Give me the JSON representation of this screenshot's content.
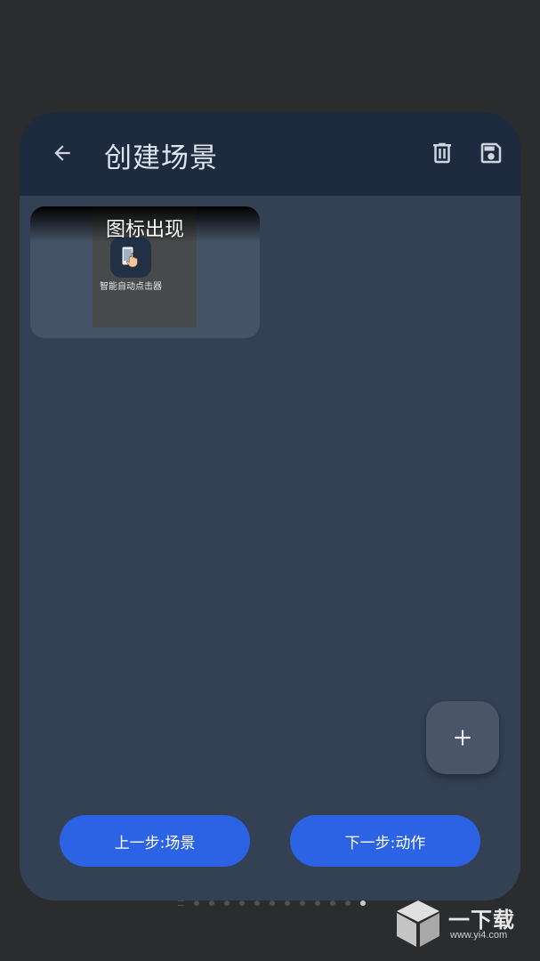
{
  "header": {
    "title": "创建场景",
    "back_icon": "arrow-left-icon",
    "delete_icon": "trash-icon",
    "save_icon": "floppy-disk-icon"
  },
  "scene_card": {
    "title": "图标出现",
    "app_name": "智能自动点击器",
    "app_icon": "tap-hand-icon"
  },
  "fab": {
    "icon": "plus-icon"
  },
  "buttons": {
    "prev_label": "上一步:场景",
    "next_label": "下一步:动作"
  },
  "watermark": {
    "text": "一下载",
    "url": "www.yi4.com"
  },
  "colors": {
    "background": "#2a2c2d",
    "card": "#344154",
    "header": "#1e2a3d",
    "accent": "#2b63e4"
  }
}
